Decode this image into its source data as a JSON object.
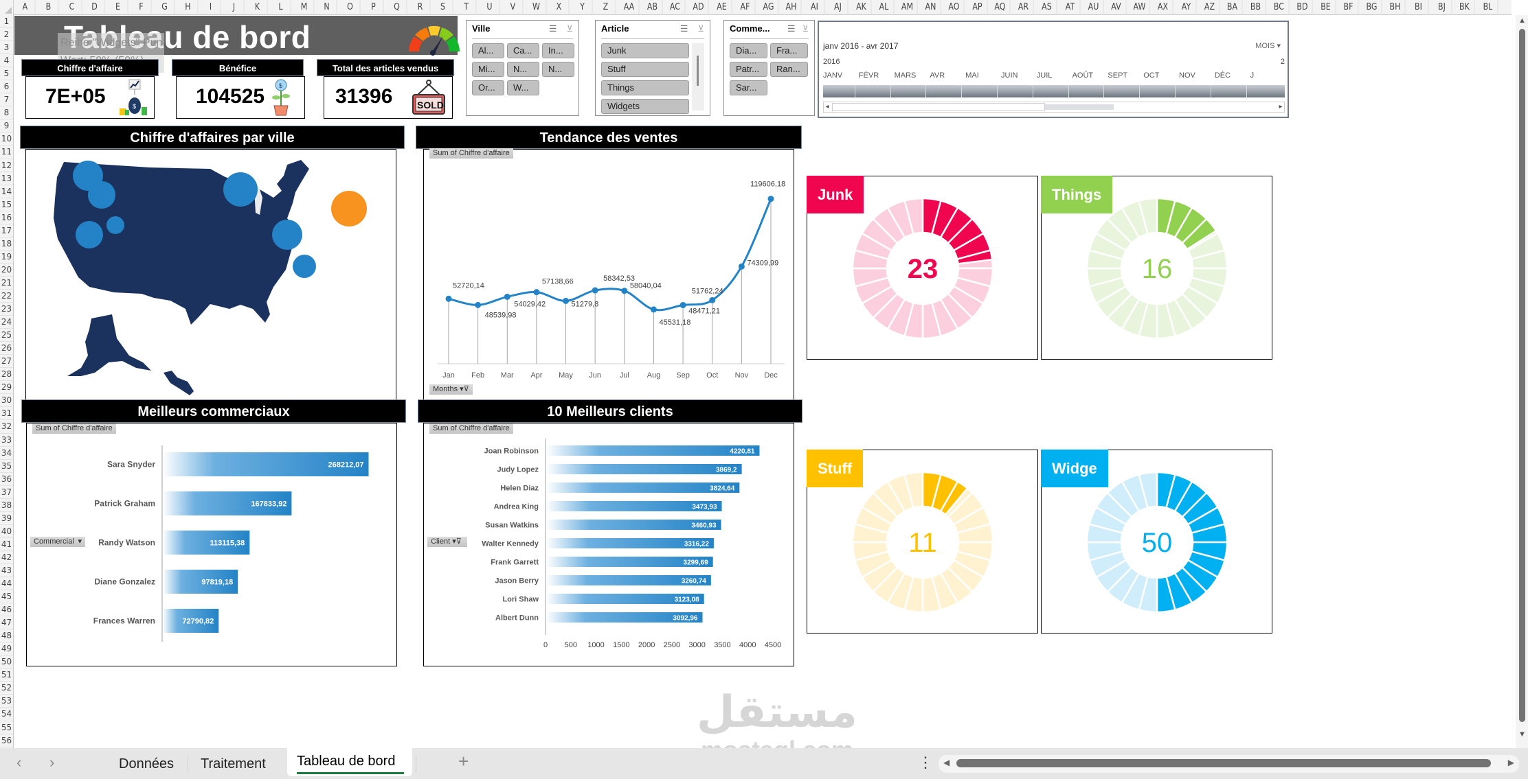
{
  "columns": [
    "A",
    "B",
    "C",
    "D",
    "E",
    "F",
    "G",
    "H",
    "I",
    "J",
    "K",
    "L",
    "M",
    "N",
    "O",
    "P",
    "Q",
    "R",
    "S",
    "T",
    "U",
    "V",
    "W",
    "X",
    "Y",
    "Z",
    "AA",
    "AB",
    "AC",
    "AD",
    "AE",
    "AF",
    "AG",
    "AH",
    "AI",
    "AJ",
    "AK",
    "AL",
    "AM",
    "AN",
    "AO",
    "AP",
    "AQ",
    "AR",
    "AS",
    "AT",
    "AU",
    "AV",
    "AW",
    "AX",
    "AY",
    "AZ",
    "BA",
    "BB",
    "BC",
    "BD",
    "BE",
    "BF",
    "BG",
    "BH",
    "BI",
    "BJ",
    "BK",
    "BL"
  ],
  "rows": [
    "1",
    "2",
    "3",
    "4",
    "5",
    "6",
    "7",
    "8",
    "9",
    "10",
    "11",
    "12",
    "13",
    "14",
    "15",
    "16",
    "17",
    "18",
    "19",
    "20",
    "21",
    "22",
    "23",
    "24",
    "25",
    "26",
    "27",
    "28",
    "29",
    "30",
    "31",
    "32",
    "33",
    "34",
    "35",
    "36",
    "37",
    "38",
    "39",
    "40",
    "41",
    "42",
    "43",
    "44",
    "45",
    "46",
    "47",
    "48",
    "49",
    "50",
    "51",
    "52",
    "53",
    "54",
    "55",
    "56"
  ],
  "header": {
    "title": "Tableau de bord",
    "tooltip_line1": "Reihe \"Widgets\" Punkt 2",
    "tooltip_line2": "Wert: 50% (50%)",
    "gauge_icon": "speedometer-icon"
  },
  "kpis": [
    {
      "label": "Chiffre d'affaire",
      "value": "7E+05",
      "icon": "money-bag-growth-icon"
    },
    {
      "label": "Bénéfice",
      "value": "104525",
      "icon": "money-plant-icon"
    },
    {
      "label": "Total des articles vendus",
      "value": "31396",
      "icon": "sold-sign-icon"
    }
  ],
  "slicers": {
    "ville": {
      "title": "Ville",
      "items": [
        "Al...",
        "Ca...",
        "In...",
        "Mi...",
        "N...",
        "N...",
        "Or...",
        "W..."
      ]
    },
    "article": {
      "title": "Article",
      "items": [
        "Junk",
        "Stuff",
        "Things",
        "Widgets"
      ]
    },
    "commercial": {
      "title": "Comme...",
      "items": [
        "Dia...",
        "Fra...",
        "Patr...",
        "Ran...",
        "Sar..."
      ]
    }
  },
  "timeline": {
    "range": "janv 2016 - avr 2017",
    "level": "MOIS",
    "year": "2016",
    "year_next": "2",
    "months": [
      "JANV",
      "FÉVR",
      "MARS",
      "AVR",
      "MAI",
      "JUIN",
      "JUIL",
      "AOÛT",
      "SEPT",
      "OCT",
      "NOV",
      "DÉC",
      "J"
    ]
  },
  "sections": {
    "map_title": "Chiffre d'affaires par ville",
    "trend_title": "Tendance des ventes",
    "sellers_title": "Meilleurs commerciaux",
    "clients_title": "10 Meilleurs clients"
  },
  "pivot_labels": {
    "sum": "Sum of Chiffre d'affaire",
    "months": "Months",
    "commercial": "Commercial",
    "client": "Client"
  },
  "map": {
    "bubbles": [
      {
        "name": "Seattle",
        "color": "#2383c6",
        "size": 0.8
      },
      {
        "name": "Portland",
        "color": "#2383c6",
        "size": 0.65
      },
      {
        "name": "San Francisco",
        "color": "#2383c6",
        "size": 0.68
      },
      {
        "name": "Las Vegas",
        "color": "#2383c6",
        "size": 0.3
      },
      {
        "name": "Minneapolis",
        "color": "#2383c6",
        "size": 0.95
      },
      {
        "name": "Indianapolis",
        "color": "#2383c6",
        "size": 0.78
      },
      {
        "name": "Atlanta",
        "color": "#2383c6",
        "size": 0.5
      },
      {
        "name": "New York",
        "color": "#f7931e",
        "size": 1.0
      }
    ]
  },
  "chart_data": [
    {
      "type": "line",
      "title": "Tendance des ventes",
      "ylabel": "Sum of Chiffre d'affaire",
      "xlabel": "Months",
      "categories": [
        "Jan",
        "Feb",
        "Mar",
        "Apr",
        "May",
        "Jun",
        "Jul",
        "Aug",
        "Sep",
        "Oct",
        "Nov",
        "Dec"
      ],
      "values": [
        52720.14,
        48539.98,
        54029.42,
        57138.66,
        51279.8,
        58342.53,
        58040.04,
        45531.18,
        48471.21,
        51762.24,
        74309.99,
        119606.18
      ],
      "labels": [
        "52720,14",
        "48539,98",
        "54029,42",
        "57138,66",
        "51279,8",
        "58342,53",
        "58040,04",
        "45531,18",
        "48471,21",
        "51762,24",
        "74309,99",
        "119606,18"
      ],
      "ylim": [
        0,
        125000
      ],
      "color": "#2383c6"
    },
    {
      "type": "bar",
      "title": "Meilleurs commerciaux",
      "categories": [
        "Sara Snyder",
        "Patrick Graham",
        "Randy Watson",
        "Diane Gonzalez",
        "Frances Warren"
      ],
      "values": [
        268212.07,
        167833.92,
        113115.38,
        97819.18,
        72790.82
      ],
      "labels": [
        "268212,07",
        "167833,92",
        "113115,38",
        "97819,18",
        "72790,82"
      ],
      "xlim": [
        0,
        300000
      ],
      "color": "#2383c6"
    },
    {
      "type": "bar",
      "title": "10 Meilleurs clients",
      "categories": [
        "Joan Robinson",
        "Judy Lopez",
        "Helen Diaz",
        "Andrea King",
        "Susan Watkins",
        "Walter Kennedy",
        "Frank Garrett",
        "Jason Berry",
        "Lori Shaw",
        "Albert Dunn"
      ],
      "values": [
        4220.81,
        3869.2,
        3824.64,
        3473.93,
        3460.93,
        3316.22,
        3299.69,
        3260.74,
        3123.08,
        3092.96
      ],
      "labels": [
        "4220,81",
        "3869,2",
        "3824,64",
        "3473,93",
        "3460,93",
        "3316,22",
        "3299,69",
        "3260,74",
        "3123,08",
        "3092,96"
      ],
      "xlim": [
        0,
        4500
      ],
      "xticks": [
        "0",
        "500",
        "1000",
        "1500",
        "2000",
        "2500",
        "3000",
        "3500",
        "4000",
        "4500"
      ],
      "color": "#2383c6"
    },
    {
      "type": "pie",
      "title": "Junk",
      "value": 23,
      "display": "23",
      "color": "#f0054f",
      "light": "#fccfdf"
    },
    {
      "type": "pie",
      "title": "Things",
      "value": 16,
      "display": "16",
      "color": "#92d050",
      "light": "#e8f5dc"
    },
    {
      "type": "pie",
      "title": "Stuff",
      "value": 11,
      "display": "11",
      "color": "#ffc000",
      "light": "#fff2d0"
    },
    {
      "type": "pie",
      "title": "Widge",
      "value": 50,
      "display": "50",
      "color": "#00b0f0",
      "light": "#cfedfa"
    }
  ],
  "tabs": {
    "items": [
      "Données",
      "Traitement",
      "Tableau de bord"
    ],
    "active": "Tableau de bord",
    "add": "+",
    "prev": "‹",
    "next": "›",
    "more": "⋮"
  },
  "watermark": {
    "arabic": "مستقل",
    "latin": "mostaql.com"
  }
}
